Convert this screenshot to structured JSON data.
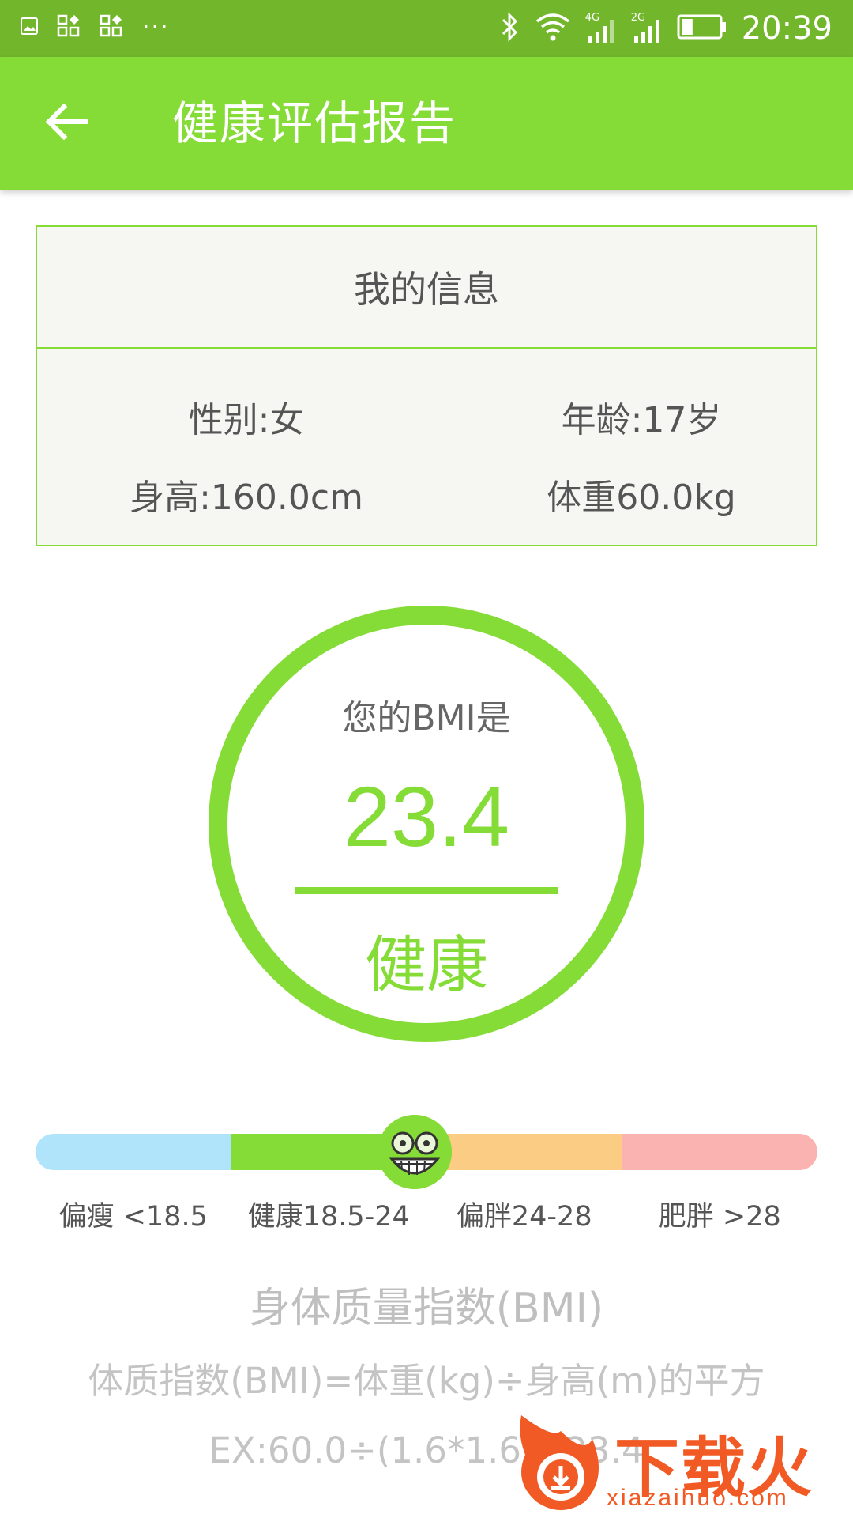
{
  "status_bar": {
    "time": "20:39",
    "left_icons": [
      "image-icon",
      "app-grid-icon",
      "app-grid-icon",
      "more-dots-icon"
    ],
    "more_dots": "···",
    "right_icons": [
      "bluetooth-icon",
      "wifi-icon",
      "signal-4g-icon",
      "signal-2g-icon",
      "battery-icon"
    ],
    "signal_1_label": "4G",
    "signal_2_label": "2G",
    "battery_level": 0.3
  },
  "app_bar": {
    "title": "健康评估报告",
    "back_icon": "arrow-left-icon",
    "background_color": "#86dc37"
  },
  "info_card": {
    "header": "我的信息",
    "gender": "性别:女",
    "age": "年龄:17岁",
    "height": "身高:160.0cm",
    "weight": "体重60.0kg"
  },
  "bmi": {
    "label": "您的BMI是",
    "value": "23.4",
    "status": "健康",
    "accent_color": "#86dc37"
  },
  "scale": {
    "segments": [
      {
        "label": "偏瘦 <18.5",
        "color": "#b0e4fb"
      },
      {
        "label": "健康18.5-24",
        "color": "#86dc37"
      },
      {
        "label": "偏胖24-28",
        "color": "#fbcd84"
      },
      {
        "label": "肥胖 >28",
        "color": "#fbb3b1"
      }
    ],
    "marker_icon": "happy-face-icon",
    "marker_position_fraction": 0.485
  },
  "explanation": {
    "title": "身体质量指数(BMI)",
    "formula": "体质指数(BMI)=体重(kg)÷身高(m)的平方",
    "example": "EX:60.0÷(1.6*1.6)=23.4"
  },
  "watermark": {
    "text": "下载火",
    "url": "xiazaihuo.com"
  }
}
